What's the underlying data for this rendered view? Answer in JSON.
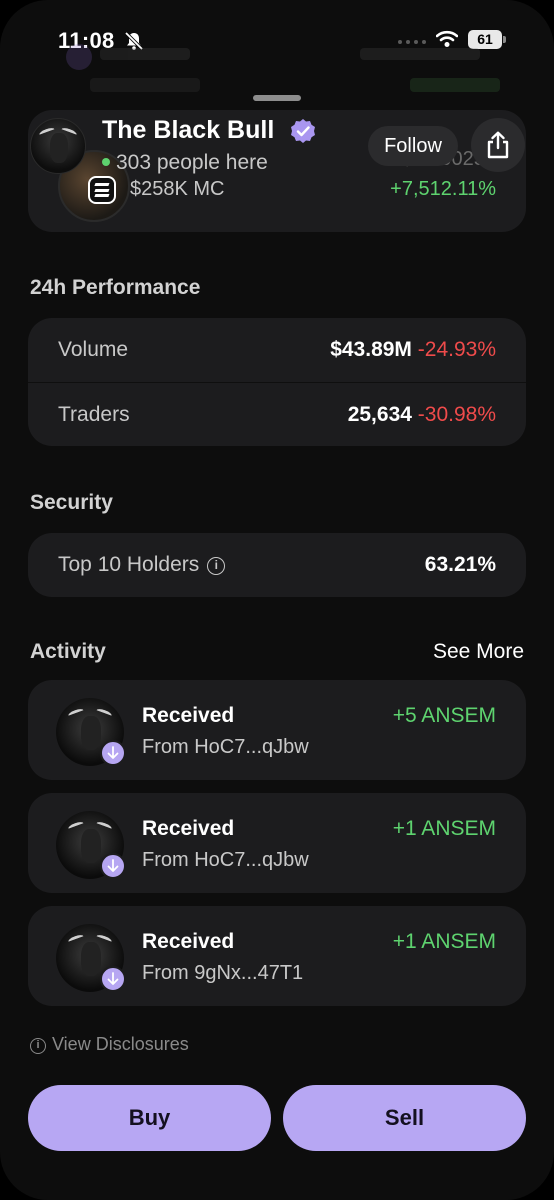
{
  "status_bar": {
    "time": "11:08",
    "battery": "61"
  },
  "token": {
    "name": "The Black Bull",
    "people_here": "303 people here",
    "market_cap": "$258K MC",
    "price_partial": "$0.000258",
    "change_pct": "+7,512.11%",
    "follow_label": "Follow"
  },
  "performance": {
    "title": "24h Performance",
    "rows": [
      {
        "label": "Volume",
        "value": "$43.89M",
        "change": "-24.93%"
      },
      {
        "label": "Traders",
        "value": "25,634",
        "change": "-30.98%"
      }
    ]
  },
  "security": {
    "title": "Security",
    "label": "Top 10 Holders",
    "value": "63.21%"
  },
  "activity": {
    "title": "Activity",
    "see_more": "See More",
    "items": [
      {
        "title": "Received",
        "from": "From HoC7...qJbw",
        "amount": "+5 ANSEM"
      },
      {
        "title": "Received",
        "from": "From HoC7...qJbw",
        "amount": "+1 ANSEM"
      },
      {
        "title": "Received",
        "from": "From 9gNx...47T1",
        "amount": "+1 ANSEM"
      }
    ]
  },
  "footer": {
    "disclosures": "View Disclosures",
    "buy_label": "Buy",
    "sell_label": "Sell"
  },
  "colors": {
    "accent": "#b7a7f3",
    "positive": "#5ed36f",
    "negative": "#ef4b4b",
    "card": "#1c1c1e"
  }
}
